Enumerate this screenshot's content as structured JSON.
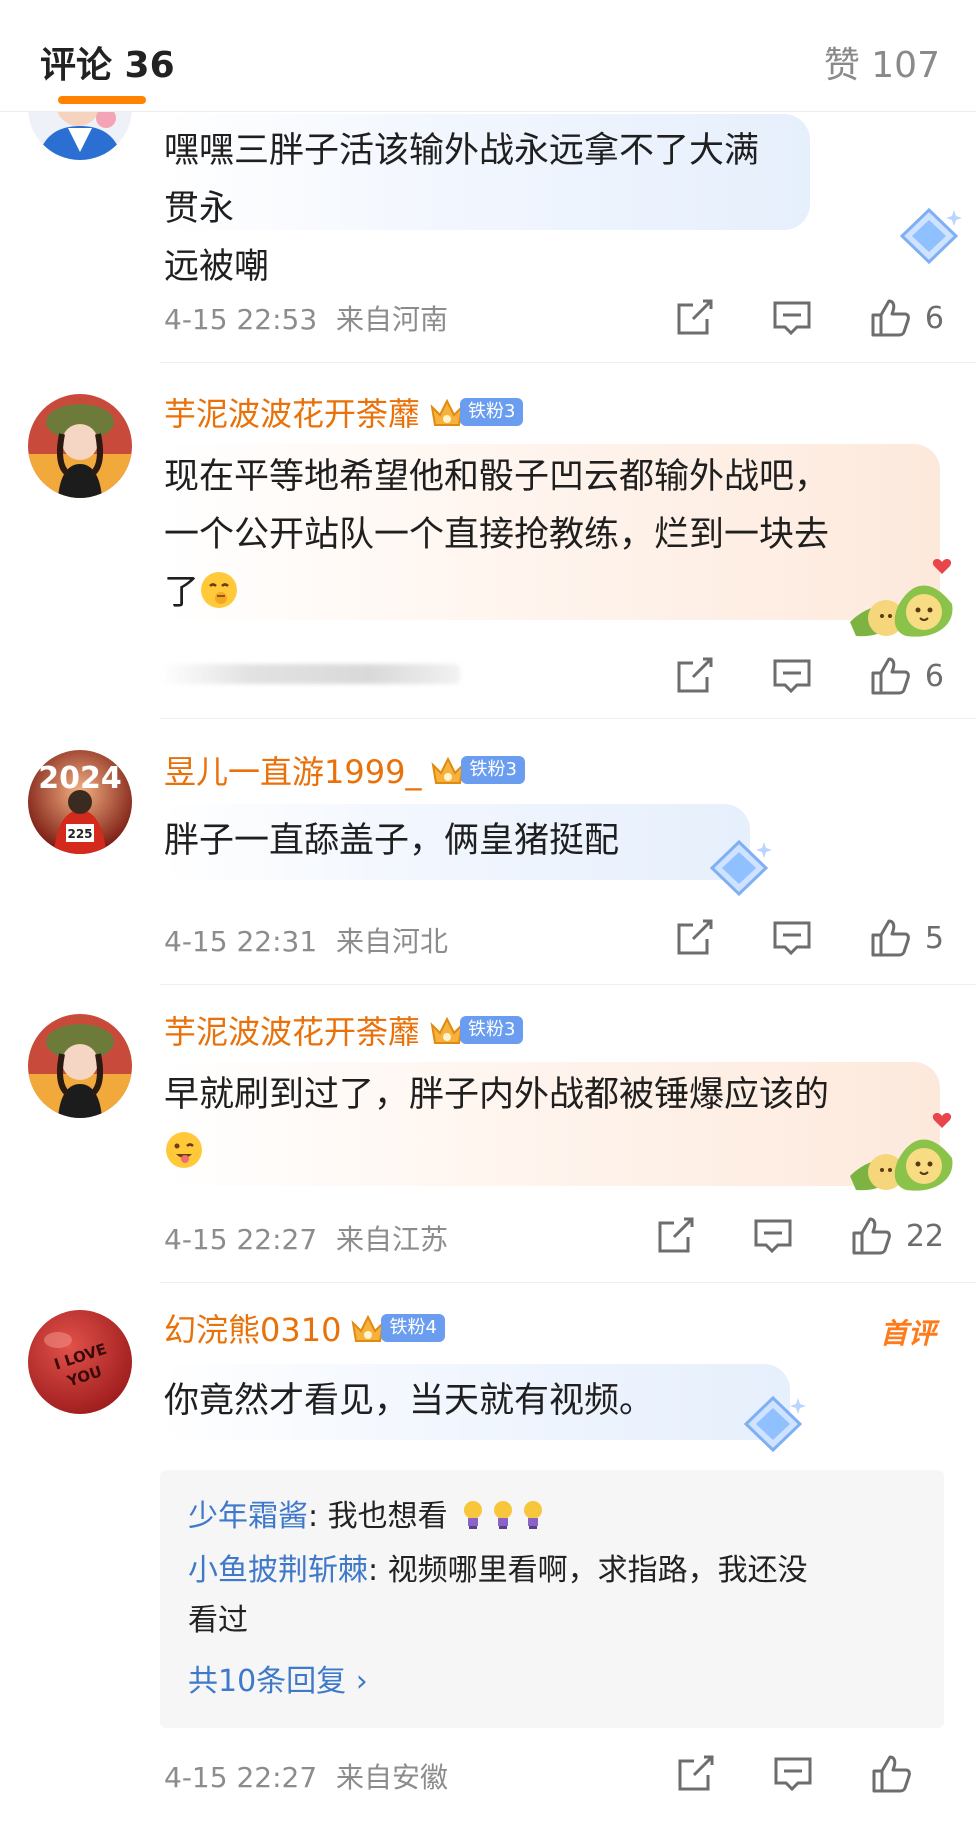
{
  "header": {
    "comments_tab": "评论 36",
    "likes_tab": "赞 107",
    "accent_color": "#ff8200"
  },
  "comments": [
    {
      "username": "",
      "text": "嘿嘿三胖子活该输外战永远拿不了大满贯永远被嘲",
      "text_lines": [
        "嘿嘿三胖子活该输外战永远拿不了大满贯永",
        "远被嘲"
      ],
      "timestamp": "4-15 22:53",
      "location": "来自河南",
      "likes": "6",
      "bubble_style": "blue-gem"
    },
    {
      "username": "芋泥波波花开荼蘼",
      "fan_badge": "铁粉3",
      "text_lines": [
        "现在平等地希望他和骰子凹云都输外战吧，",
        "一个公开站队一个直接抢教练，烂到一块去",
        "了"
      ],
      "timestamp": "",
      "location": "",
      "likes": "6",
      "bubble_style": "peach-dumpling"
    },
    {
      "username": "昱儿一直游1999_",
      "fan_badge": "铁粉3",
      "text_lines": [
        "胖子一直舔盖子，俩皇猪挺配"
      ],
      "timestamp": "4-15 22:31",
      "location": "来自河北",
      "likes": "5",
      "bubble_style": "blue-gem"
    },
    {
      "username": "芋泥波波花开荼蘼",
      "fan_badge": "铁粉3",
      "text_lines": [
        "早就刷到过了，胖子内外战都被锤爆应该的"
      ],
      "timestamp": "4-15 22:27",
      "location": "来自江苏",
      "likes": "22",
      "bubble_style": "peach-dumpling"
    },
    {
      "username": "幻浣熊0310",
      "fan_badge": "铁粉4",
      "first_comment_tag": "首评",
      "text_lines": [
        "你竟然才看见，当天就有视频。"
      ],
      "timestamp": "4-15 22:27",
      "location": "来自安徽",
      "likes": "",
      "bubble_style": "blue-gem",
      "replies": [
        {
          "name": "少年霜酱",
          "sep": ": ",
          "text": "我也想看"
        },
        {
          "name": "小鱼披荆斩棘",
          "sep": ": ",
          "text_line1": "视频哪里看啊，求指路，我还没",
          "text_line2": "看过"
        }
      ],
      "more_replies": "共10条回复 ›"
    }
  ],
  "avatar_texts": {
    "a3_year": "2024",
    "a3_bib": "225",
    "a5_line1": "I LOVE",
    "a5_line2": "YOU"
  },
  "colors": {
    "username": "#e8710a",
    "reply_name": "#3f79c9",
    "meta": "#8c8c8c",
    "fan_badge": "#6a9df0"
  }
}
